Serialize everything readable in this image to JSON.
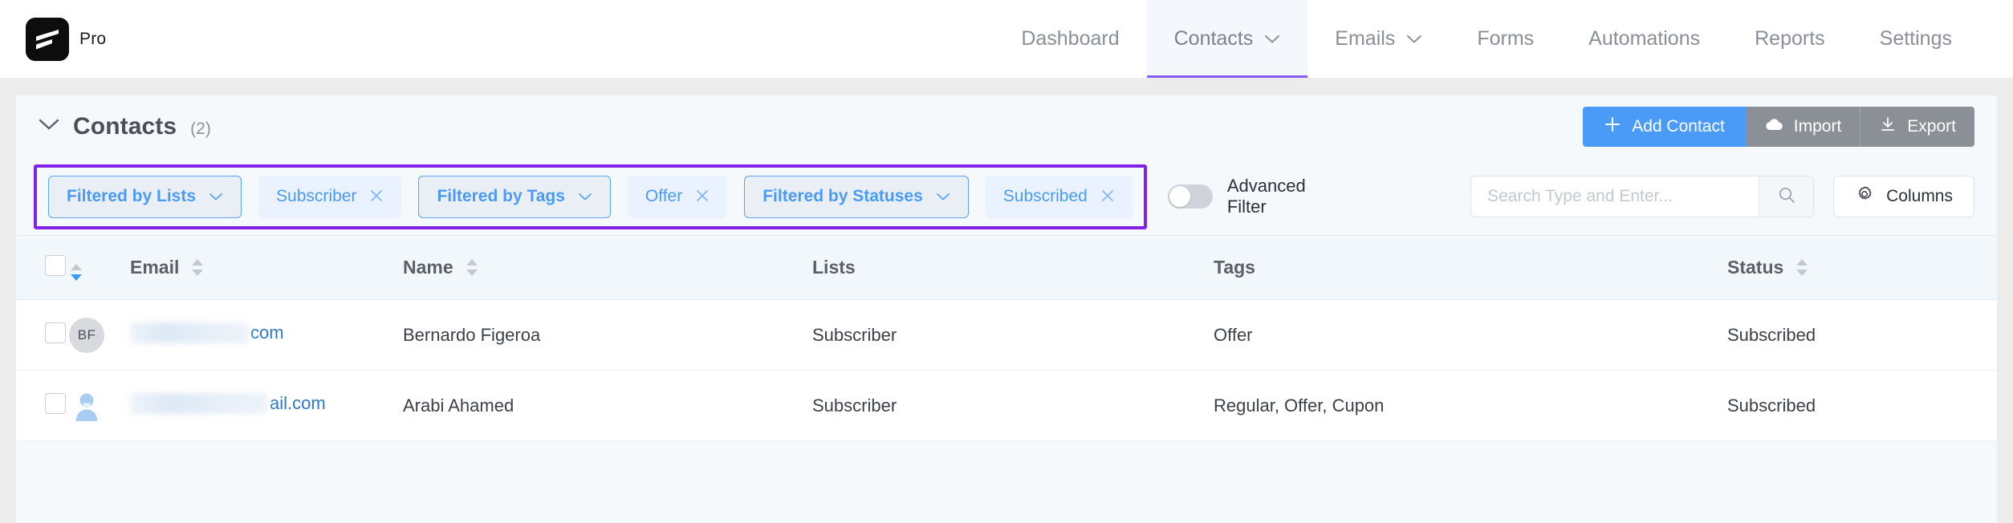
{
  "brand": {
    "name": "Pro",
    "logo_icon": "fluentcrm-logo-icon"
  },
  "nav": {
    "items": [
      {
        "label": "Dashboard",
        "has_caret": false,
        "active": false
      },
      {
        "label": "Contacts",
        "has_caret": true,
        "active": true
      },
      {
        "label": "Emails",
        "has_caret": true,
        "active": false
      },
      {
        "label": "Forms",
        "has_caret": false,
        "active": false
      },
      {
        "label": "Automations",
        "has_caret": false,
        "active": false
      },
      {
        "label": "Reports",
        "has_caret": false,
        "active": false
      },
      {
        "label": "Settings",
        "has_caret": false,
        "active": false
      }
    ]
  },
  "panel": {
    "title": "Contacts",
    "count": "(2)",
    "collapse_icon": "chevron-down-icon",
    "actions": {
      "add_contact": "Add Contact",
      "add_contact_icon": "plus-icon",
      "import": "Import",
      "import_icon": "cloud-upload-icon",
      "export": "Export",
      "export_icon": "download-icon"
    }
  },
  "filters": {
    "highlight_color": "#8223e8",
    "chips": [
      {
        "label": "Filtered by Lists",
        "type": "dropdown",
        "icon": "chevron-down-icon"
      },
      {
        "label": "Subscriber",
        "type": "value",
        "icon": "close-icon"
      },
      {
        "label": "Filtered by Tags",
        "type": "dropdown",
        "icon": "chevron-down-icon"
      },
      {
        "label": "Offer",
        "type": "value",
        "icon": "close-icon"
      },
      {
        "label": "Filtered by Statuses",
        "type": "dropdown",
        "icon": "chevron-down-icon"
      },
      {
        "label": "Subscribed",
        "type": "value",
        "icon": "close-icon"
      }
    ],
    "advanced_filter": {
      "label": "Advanced Filter",
      "enabled": false
    },
    "search": {
      "placeholder": "Search Type and Enter...",
      "value": "",
      "icon": "search-icon"
    },
    "columns_button": {
      "label": "Columns",
      "icon": "gear-icon"
    }
  },
  "table": {
    "columns": [
      {
        "key": "checkbox",
        "label": "",
        "sortable": false
      },
      {
        "key": "avatar",
        "label": "",
        "sortable": true,
        "sort_state": "desc"
      },
      {
        "key": "email",
        "label": "Email",
        "sortable": true,
        "sort_state": "none"
      },
      {
        "key": "name",
        "label": "Name",
        "sortable": true,
        "sort_state": "none"
      },
      {
        "key": "lists",
        "label": "Lists",
        "sortable": false
      },
      {
        "key": "tags",
        "label": "Tags",
        "sortable": false
      },
      {
        "key": "status",
        "label": "Status",
        "sortable": true,
        "sort_state": "none"
      }
    ],
    "rows": [
      {
        "avatar_type": "initials",
        "avatar_initials": "BF",
        "email_masked": true,
        "email_tail": "com",
        "name": "Bernardo Figeroa",
        "lists": "Subscriber",
        "tags": "Offer",
        "status": "Subscribed"
      },
      {
        "avatar_type": "person-icon",
        "avatar_initials": "",
        "email_masked": true,
        "email_tail": "ail.com",
        "name": "Arabi Ahamed",
        "lists": "Subscriber",
        "tags": "Regular, Offer, Cupon",
        "status": "Subscribed"
      }
    ]
  }
}
